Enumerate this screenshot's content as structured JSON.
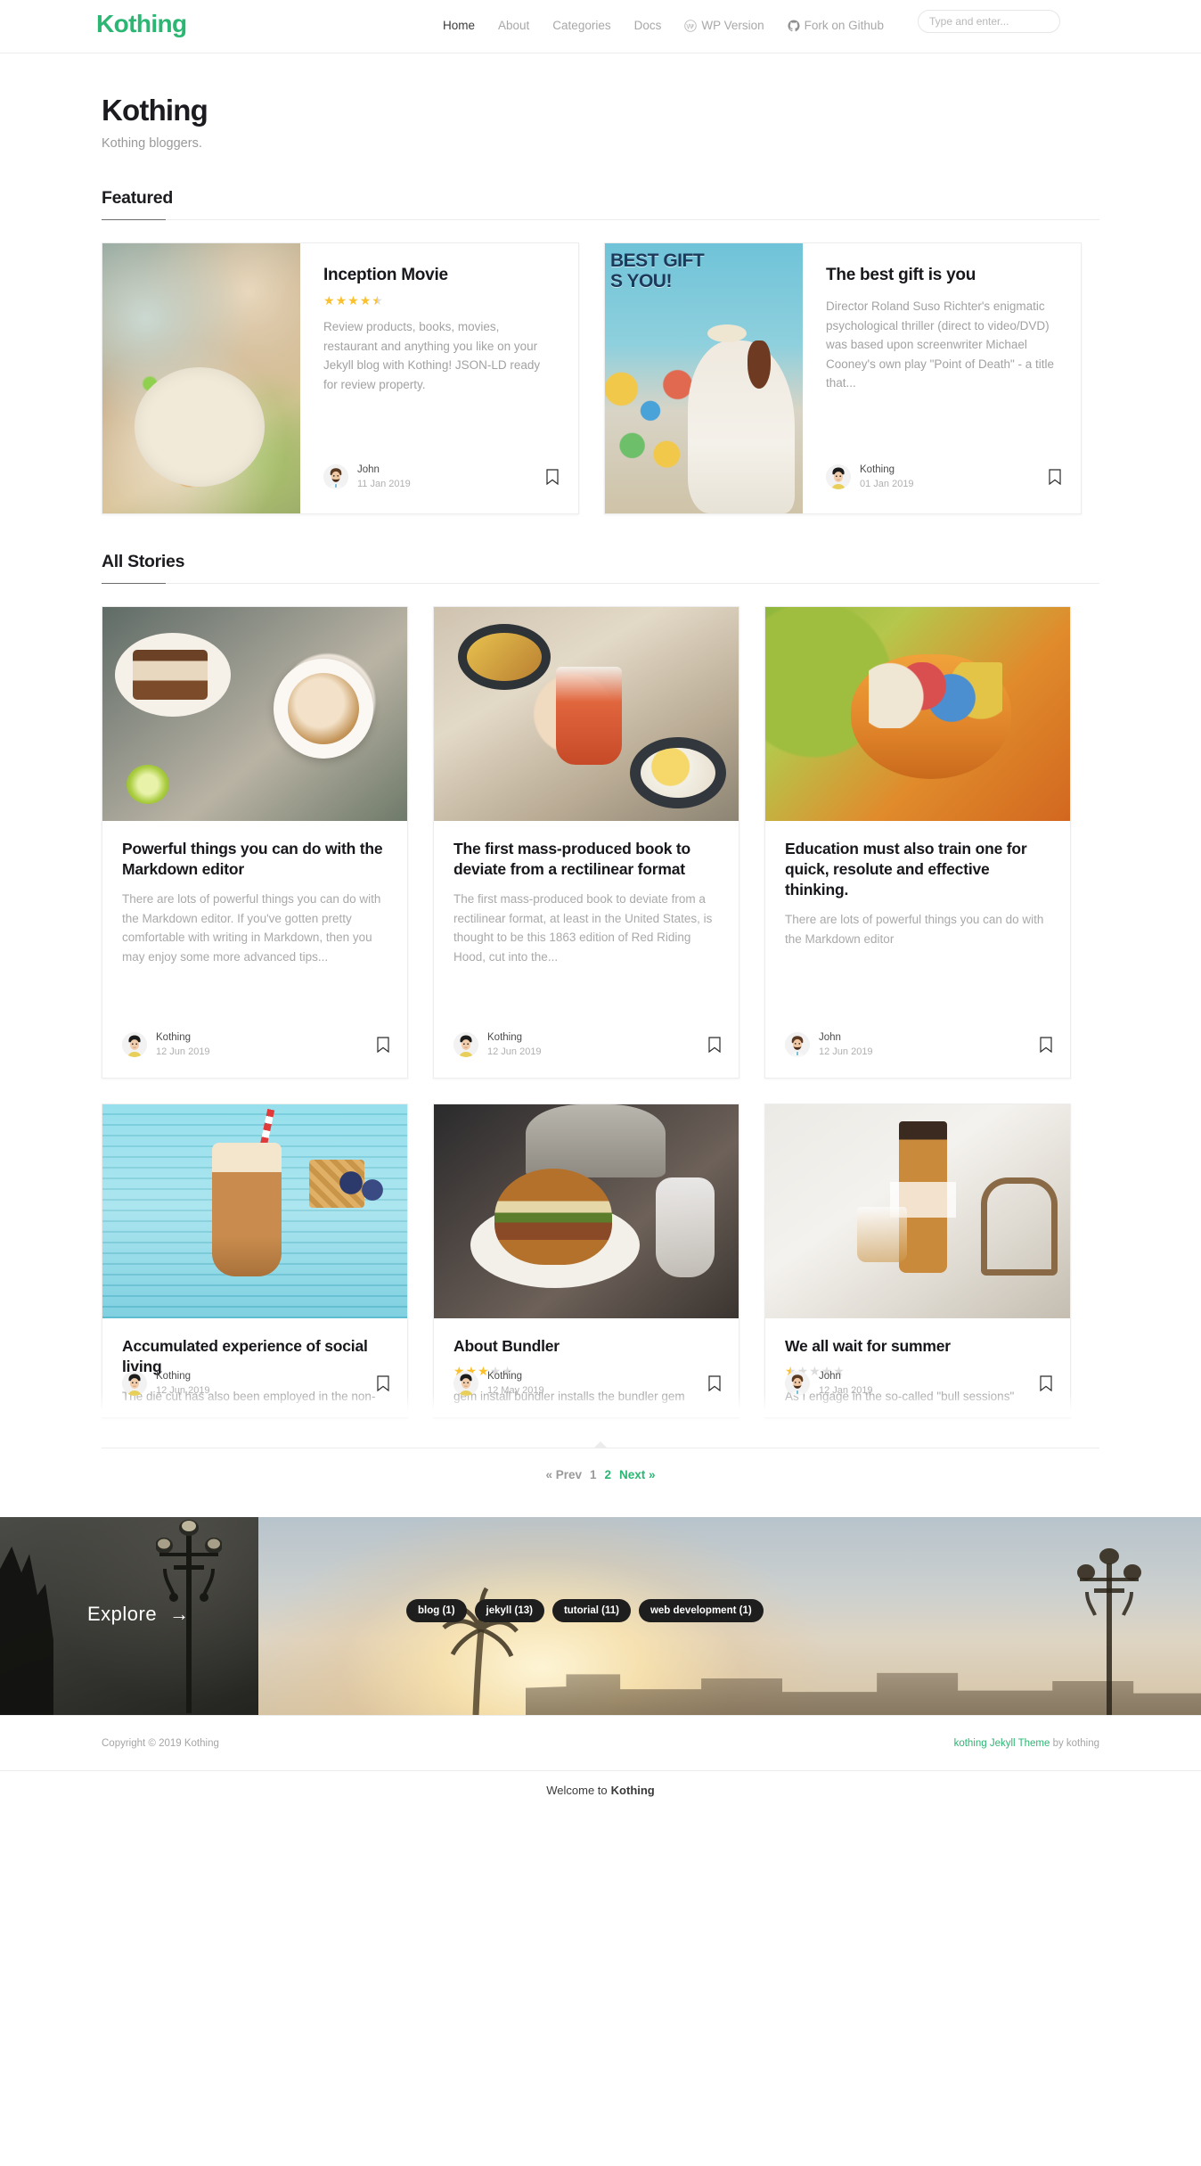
{
  "header": {
    "brand": "Kothing",
    "nav": [
      {
        "label": "Home",
        "active": true,
        "icon": null
      },
      {
        "label": "About",
        "active": false,
        "icon": null
      },
      {
        "label": "Categories",
        "active": false,
        "icon": null
      },
      {
        "label": "Docs",
        "active": false,
        "icon": null
      },
      {
        "label": "WP Version",
        "active": false,
        "icon": "wordpress-icon"
      },
      {
        "label": "Fork on Github",
        "active": false,
        "icon": "github-icon"
      }
    ],
    "search": {
      "placeholder": "Type and enter...",
      "value": ""
    }
  },
  "page": {
    "title": "Kothing",
    "subtitle": "Kothing bloggers."
  },
  "featured": {
    "heading": "Featured",
    "cards": [
      {
        "title": "Inception Movie",
        "rating": 4.5,
        "excerpt": "Review products, books, movies, restaurant and anything you like on your Jekyll blog with Kothing! JSON-LD ready for review property.",
        "author": "John",
        "date": "11 Jan 2019",
        "thumb": "tacos-photo",
        "bookmark_icon": "bookmark-icon"
      },
      {
        "title": "The best gift is you",
        "rating": null,
        "excerpt": "Director Roland Suso Richter's enigmatic psychological thriller (direct to video/DVD) was based upon screenwriter Michael Cooney's own play \"Point of Death\" - a title that...",
        "author": "Kothing",
        "date": "01 Jan 2019",
        "thumb": "best-gift-photo",
        "bookmark_icon": "bookmark-icon"
      }
    ]
  },
  "all_stories": {
    "heading": "All Stories",
    "row1": [
      {
        "title": "Powerful things you can do with the Markdown editor",
        "rating": null,
        "excerpt": "There are lots of powerful things you can do with the Markdown editor. If you've gotten pretty comfortable with writing in Markdown, then you may enjoy some more advanced tips...",
        "author": "Kothing",
        "date": "12 Jun 2019",
        "thumb": "coffee-cake-photo",
        "bookmark_icon": "bookmark-icon"
      },
      {
        "title": "The first mass-produced book to deviate from a rectilinear format",
        "rating": null,
        "excerpt": "The first mass-produced book to deviate from a rectilinear format, at least in the United States, is thought to be this 1863 edition of Red Riding Hood, cut into the...",
        "author": "Kothing",
        "date": "12 Jun 2019",
        "thumb": "cocktail-brunch-photo",
        "bookmark_icon": "bookmark-icon"
      },
      {
        "title": "Education must also train one for quick, resolute and effective thinking.",
        "rating": null,
        "excerpt": "There are lots of powerful things you can do with the Markdown editor",
        "author": "John",
        "date": "12 Jun 2019",
        "thumb": "carrot-basket-photo",
        "bookmark_icon": "bookmark-icon"
      }
    ],
    "row2": [
      {
        "title": "Accumulated experience of social living",
        "rating": null,
        "excerpt": "The die cut has also been employed in the non-juvenile sphere as well, a recent example being Jonathan Safran Foer's ambitious Tree of Codes.",
        "author": "Kothing",
        "date": "12 Jun 2019",
        "thumb": "ice-cream-float-photo",
        "bookmark_icon": "bookmark-icon"
      },
      {
        "title": "About Bundler",
        "rating": 3,
        "excerpt": "gem install bundler installs the bundler gem through RubyGems. You only need to install it once - not every time you create a new Jekyll project. Here are some additional...",
        "author": "Kothing",
        "date": "12 May 2019",
        "thumb": "burger-photo",
        "bookmark_icon": "bookmark-icon"
      },
      {
        "title": "We all wait for summer",
        "rating": 0.5,
        "excerpt": "As I engage in the so-called \"bull sessions\" around and about the school, I too often find that most college men have a misconception of the purpose of education. Most...",
        "author": "John",
        "date": "12 Jan 2019",
        "thumb": "whisky-bottle-photo",
        "bookmark_icon": "bookmark-icon"
      }
    ]
  },
  "pagination": {
    "prev": "« Prev",
    "pages": [
      {
        "label": "1",
        "current": false
      },
      {
        "label": "2",
        "current": true
      }
    ],
    "next": "Next »"
  },
  "explore": {
    "label": "Explore",
    "arrow": "→",
    "tags": [
      {
        "label": "blog (1)"
      },
      {
        "label": "jekyll (13)"
      },
      {
        "label": "tutorial (11)"
      },
      {
        "label": "web development (1)"
      }
    ]
  },
  "footer": {
    "copyright": "Copyright © 2019 Kothing",
    "theme_link": "kothing Jekyll Theme",
    "theme_by": " by kothing"
  },
  "status_bar": {
    "prefix": "Welcome to ",
    "brand": "Kothing"
  },
  "colors": {
    "brand_green": "#2bb673",
    "star_gold": "#fbc02d",
    "text_dark": "#17171c",
    "text_muted": "#a9a9a9",
    "border": "#ededed",
    "tag_bg": "#1e1e1e"
  }
}
